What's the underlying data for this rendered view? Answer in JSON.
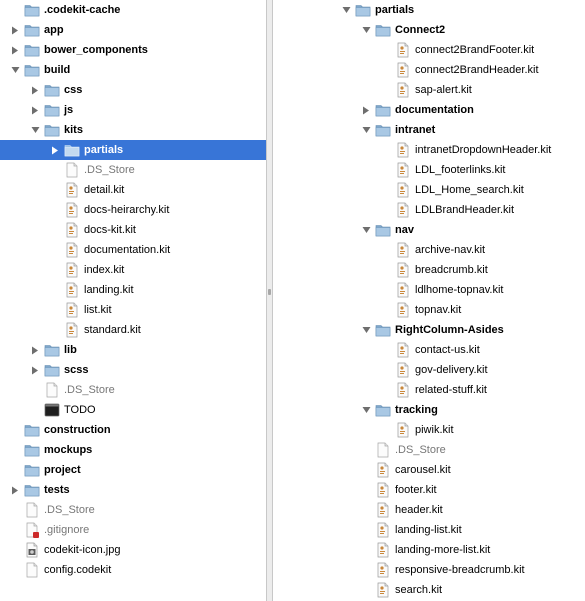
{
  "colors": {
    "selection": "#3875d7",
    "folder": "#8fb5d6",
    "dim_text": "#777777"
  },
  "left_pane": {
    "rows": [
      {
        "name": ".codekit-cache",
        "kind": "folder",
        "level": 0,
        "tri": "none",
        "dim": false
      },
      {
        "name": "app",
        "kind": "folder",
        "level": 0,
        "tri": "right",
        "dim": false
      },
      {
        "name": "bower_components",
        "kind": "folder",
        "level": 0,
        "tri": "right",
        "dim": false
      },
      {
        "name": "build",
        "kind": "folder",
        "level": 0,
        "tri": "down",
        "dim": false
      },
      {
        "name": "css",
        "kind": "folder",
        "level": 1,
        "tri": "right",
        "dim": false
      },
      {
        "name": "js",
        "kind": "folder",
        "level": 1,
        "tri": "right",
        "dim": false
      },
      {
        "name": "kits",
        "kind": "folder",
        "level": 1,
        "tri": "down",
        "dim": false
      },
      {
        "name": "partials",
        "kind": "folder",
        "level": 2,
        "tri": "right",
        "dim": false,
        "selected": true
      },
      {
        "name": ".DS_Store",
        "kind": "doc",
        "level": 2,
        "tri": "none",
        "dim": true
      },
      {
        "name": "detail.kit",
        "kind": "kit",
        "level": 2,
        "tri": "none",
        "dim": false
      },
      {
        "name": "docs-heirarchy.kit",
        "kind": "kit",
        "level": 2,
        "tri": "none",
        "dim": false
      },
      {
        "name": "docs-kit.kit",
        "kind": "kit",
        "level": 2,
        "tri": "none",
        "dim": false
      },
      {
        "name": "documentation.kit",
        "kind": "kit",
        "level": 2,
        "tri": "none",
        "dim": false
      },
      {
        "name": "index.kit",
        "kind": "kit",
        "level": 2,
        "tri": "none",
        "dim": false
      },
      {
        "name": "landing.kit",
        "kind": "kit",
        "level": 2,
        "tri": "none",
        "dim": false
      },
      {
        "name": "list.kit",
        "kind": "kit",
        "level": 2,
        "tri": "none",
        "dim": false
      },
      {
        "name": "standard.kit",
        "kind": "kit",
        "level": 2,
        "tri": "none",
        "dim": false
      },
      {
        "name": "lib",
        "kind": "folder",
        "level": 1,
        "tri": "right",
        "dim": false
      },
      {
        "name": "scss",
        "kind": "folder",
        "level": 1,
        "tri": "right",
        "dim": false
      },
      {
        "name": ".DS_Store",
        "kind": "doc",
        "level": 1,
        "tri": "none",
        "dim": true
      },
      {
        "name": "TODO",
        "kind": "exec",
        "level": 1,
        "tri": "none",
        "dim": false,
        "plain": true
      },
      {
        "name": "construction",
        "kind": "folder",
        "level": 0,
        "tri": "none",
        "dim": false
      },
      {
        "name": "mockups",
        "kind": "folder",
        "level": 0,
        "tri": "none",
        "dim": false
      },
      {
        "name": "project",
        "kind": "folder",
        "level": 0,
        "tri": "none",
        "dim": false
      },
      {
        "name": "tests",
        "kind": "folder",
        "level": 0,
        "tri": "right",
        "dim": false
      },
      {
        "name": ".DS_Store",
        "kind": "doc",
        "level": 0,
        "tri": "none",
        "dim": true
      },
      {
        "name": ".gitignore",
        "kind": "gitignore",
        "level": 0,
        "tri": "none",
        "dim": true
      },
      {
        "name": "codekit-icon.jpg",
        "kind": "image",
        "level": 0,
        "tri": "none",
        "dim": false
      },
      {
        "name": "config.codekit",
        "kind": "doc",
        "level": 0,
        "tri": "none",
        "dim": false
      }
    ]
  },
  "right_pane": {
    "rows": [
      {
        "name": "partials",
        "kind": "folder",
        "level": 0,
        "tri": "down",
        "dim": false
      },
      {
        "name": "Connect2",
        "kind": "folder",
        "level": 1,
        "tri": "down",
        "dim": false
      },
      {
        "name": "connect2BrandFooter.kit",
        "kind": "kit",
        "level": 2,
        "tri": "none",
        "dim": false
      },
      {
        "name": "connect2BrandHeader.kit",
        "kind": "kit",
        "level": 2,
        "tri": "none",
        "dim": false
      },
      {
        "name": "sap-alert.kit",
        "kind": "kit",
        "level": 2,
        "tri": "none",
        "dim": false
      },
      {
        "name": "documentation",
        "kind": "folder",
        "level": 1,
        "tri": "right",
        "dim": false
      },
      {
        "name": "intranet",
        "kind": "folder",
        "level": 1,
        "tri": "down",
        "dim": false
      },
      {
        "name": "intranetDropdownHeader.kit",
        "kind": "kit",
        "level": 2,
        "tri": "none",
        "dim": false
      },
      {
        "name": "LDL_footerlinks.kit",
        "kind": "kit",
        "level": 2,
        "tri": "none",
        "dim": false
      },
      {
        "name": "LDL_Home_search.kit",
        "kind": "kit",
        "level": 2,
        "tri": "none",
        "dim": false
      },
      {
        "name": "LDLBrandHeader.kit",
        "kind": "kit",
        "level": 2,
        "tri": "none",
        "dim": false
      },
      {
        "name": "nav",
        "kind": "folder",
        "level": 1,
        "tri": "down",
        "dim": false
      },
      {
        "name": "archive-nav.kit",
        "kind": "kit",
        "level": 2,
        "tri": "none",
        "dim": false
      },
      {
        "name": "breadcrumb.kit",
        "kind": "kit",
        "level": 2,
        "tri": "none",
        "dim": false
      },
      {
        "name": "ldlhome-topnav.kit",
        "kind": "kit",
        "level": 2,
        "tri": "none",
        "dim": false
      },
      {
        "name": "topnav.kit",
        "kind": "kit",
        "level": 2,
        "tri": "none",
        "dim": false
      },
      {
        "name": "RightColumn-Asides",
        "kind": "folder",
        "level": 1,
        "tri": "down",
        "dim": false
      },
      {
        "name": "contact-us.kit",
        "kind": "kit",
        "level": 2,
        "tri": "none",
        "dim": false
      },
      {
        "name": "gov-delivery.kit",
        "kind": "kit",
        "level": 2,
        "tri": "none",
        "dim": false
      },
      {
        "name": "related-stuff.kit",
        "kind": "kit",
        "level": 2,
        "tri": "none",
        "dim": false
      },
      {
        "name": "tracking",
        "kind": "folder",
        "level": 1,
        "tri": "down",
        "dim": false
      },
      {
        "name": "piwik.kit",
        "kind": "kit",
        "level": 2,
        "tri": "none",
        "dim": false
      },
      {
        "name": ".DS_Store",
        "kind": "doc",
        "level": 1,
        "tri": "none",
        "dim": true
      },
      {
        "name": "carousel.kit",
        "kind": "kit",
        "level": 1,
        "tri": "none",
        "dim": false
      },
      {
        "name": "footer.kit",
        "kind": "kit",
        "level": 1,
        "tri": "none",
        "dim": false
      },
      {
        "name": "header.kit",
        "kind": "kit",
        "level": 1,
        "tri": "none",
        "dim": false
      },
      {
        "name": "landing-list.kit",
        "kind": "kit",
        "level": 1,
        "tri": "none",
        "dim": false
      },
      {
        "name": "landing-more-list.kit",
        "kind": "kit",
        "level": 1,
        "tri": "none",
        "dim": false
      },
      {
        "name": "responsive-breadcrumb.kit",
        "kind": "kit",
        "level": 1,
        "tri": "none",
        "dim": false
      },
      {
        "name": "search.kit",
        "kind": "kit",
        "level": 1,
        "tri": "none",
        "dim": false
      }
    ]
  }
}
